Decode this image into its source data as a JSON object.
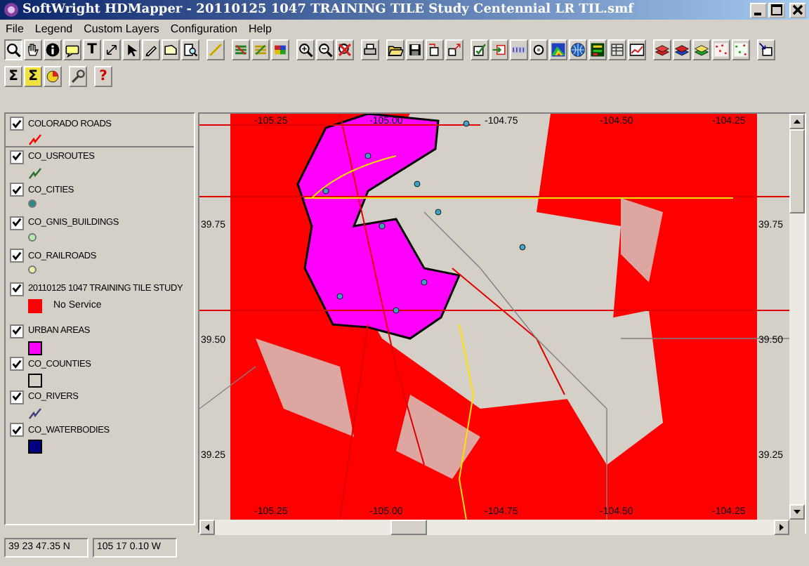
{
  "window": {
    "title": "SoftWright HDMapper - 20110125 1047 TRAINING TILE Study Centennial LR TIL.smf"
  },
  "menu": [
    "File",
    "Legend",
    "Custom Layers",
    "Configuration",
    "Help"
  ],
  "toolbar_glyphs": [
    "T",
    "Σ",
    "Σ",
    "?"
  ],
  "legend": [
    {
      "name": "COLORADO ROADS",
      "checked": true,
      "kind": "line",
      "color": "#ff0000"
    },
    {
      "name": "CO_USROUTES",
      "checked": true,
      "kind": "line",
      "color": "#2e6b2e"
    },
    {
      "name": "CO_CITIES",
      "checked": true,
      "kind": "dot",
      "color": "#2a8a8a"
    },
    {
      "name": "CO_GNIS_BUILDINGS",
      "checked": true,
      "kind": "dot",
      "color": "#b8e8b0"
    },
    {
      "name": "CO_RAILROADS",
      "checked": true,
      "kind": "dot",
      "color": "#e8e8b0"
    },
    {
      "name": "20110125 1047 TRAINING TILE STUDY",
      "checked": true,
      "kind": "class",
      "color": "#ff0000",
      "label": "No Service"
    },
    {
      "name": "URBAN AREAS",
      "checked": true,
      "kind": "square",
      "color": "#ff00ff"
    },
    {
      "name": "CO_COUNTIES",
      "checked": true,
      "kind": "square",
      "color": "#d4d0c8"
    },
    {
      "name": "CO_RIVERS",
      "checked": true,
      "kind": "line",
      "color": "#404080"
    },
    {
      "name": "CO_WATERBODIES",
      "checked": true,
      "kind": "square",
      "color": "#000080"
    }
  ],
  "map": {
    "top_labels": [
      "-105.25",
      "-105.00",
      "-104.75",
      "-104.50",
      "-104.25"
    ],
    "bottom_labels": [
      "-105.25",
      "-105.00",
      "-104.75",
      "-104.50",
      "-104.25"
    ],
    "left_labels": [
      "39.75",
      "39.50",
      "39.25"
    ],
    "right_labels": [
      "39.75",
      "39.50",
      "39.25"
    ]
  },
  "status_bar": [
    "39 23 47.35 N",
    "105 17 0.10 W"
  ]
}
